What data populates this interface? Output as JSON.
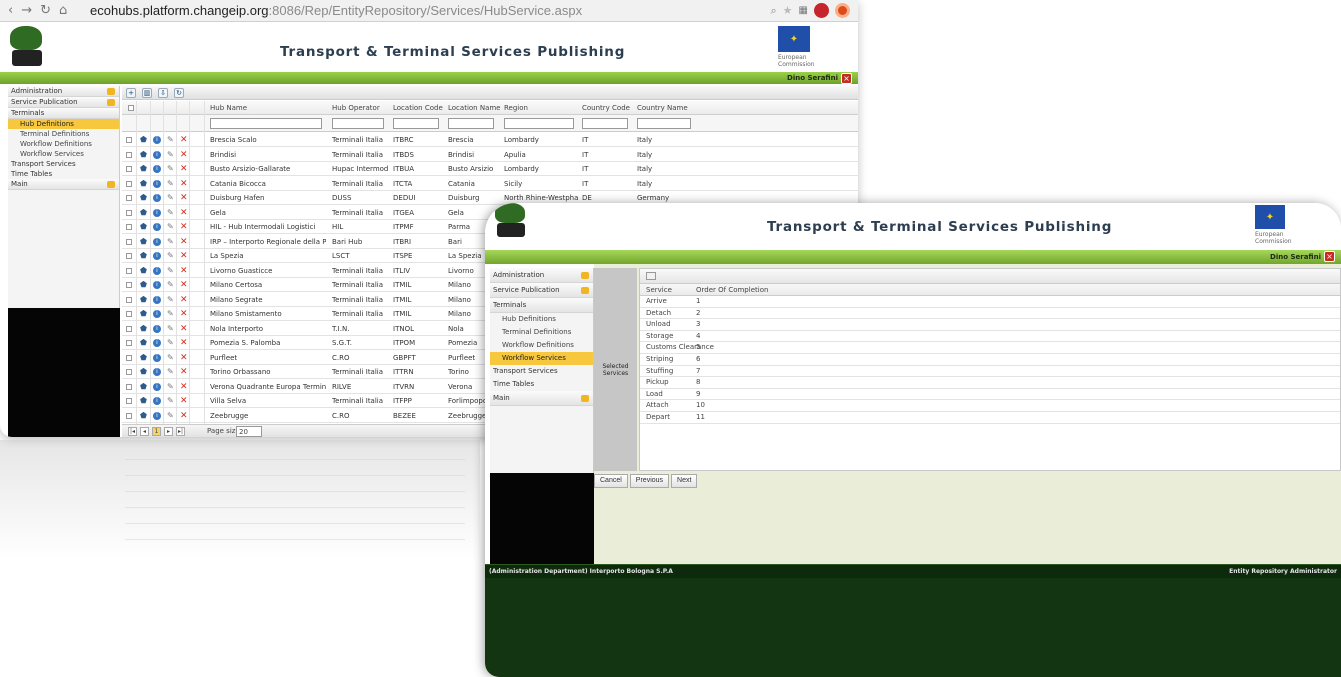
{
  "back": {
    "browser": {
      "url_host": "ecohubs.platform.changeip.org",
      "url_path": ":8086/Rep/EntityRepository/Services/HubService.aspx"
    },
    "title": "Transport & Terminal Services Publishing",
    "eu_caption": "European Commission",
    "user": "Dino Serafini",
    "menu": {
      "administration": "Administration",
      "service_publication": "Service Publication",
      "terminals": "Terminals",
      "hub_definitions": "Hub Definitions",
      "terminal_definitions": "Terminal Definitions",
      "workflow_definitions": "Workflow Definitions",
      "workflow_services": "Workflow Services",
      "transport_services": "Transport Services",
      "time_tables": "Time Tables",
      "main": "Main"
    },
    "columns": [
      "Hub Name",
      "Hub Operator",
      "Location Code",
      "Location Name",
      "Region",
      "Country Code",
      "Country Name"
    ],
    "rows": [
      [
        "Brescia Scalo",
        "Terminali Italia",
        "ITBRC",
        "Brescia",
        "Lombardy",
        "IT",
        "Italy"
      ],
      [
        "Brindisi",
        "Terminali Italia",
        "ITBDS",
        "Brindisi",
        "Apulia",
        "IT",
        "Italy"
      ],
      [
        "Busto Arsizio-Gallarate",
        "Hupac Intermodal",
        "ITBUA",
        "Busto Arsizio",
        "Lombardy",
        "IT",
        "Italy"
      ],
      [
        "Catania Bicocca",
        "Terminali Italia",
        "ITCTA",
        "Catania",
        "Sicily",
        "IT",
        "Italy"
      ],
      [
        "Duisburg Hafen",
        "DUSS",
        "DEDUI",
        "Duisburg",
        "North Rhine-Westphalia",
        "DE",
        "Germany"
      ],
      [
        "Gela",
        "Terminali Italia",
        "ITGEA",
        "Gela",
        "",
        "",
        ""
      ],
      [
        "HIL - Hub Intermodali Logistici",
        "HIL",
        "ITPMF",
        "Parma",
        "",
        "",
        ""
      ],
      [
        "IRP – Interporto Regionale della Puglia",
        "Bari Hub",
        "ITBRI",
        "Bari",
        "",
        "",
        ""
      ],
      [
        "La Spezia",
        "LSCT",
        "ITSPE",
        "La Spezia",
        "",
        "",
        ""
      ],
      [
        "Livorno Guasticce",
        "Terminali Italia",
        "ITLIV",
        "Livorno",
        "",
        "",
        ""
      ],
      [
        "Milano Certosa",
        "Terminali Italia",
        "ITMIL",
        "Milano",
        "",
        "",
        ""
      ],
      [
        "Milano Segrate",
        "Terminali Italia",
        "ITMIL",
        "Milano",
        "",
        "",
        ""
      ],
      [
        "Milano Smistamento",
        "Terminali Italia",
        "ITMIL",
        "Milano",
        "",
        "",
        ""
      ],
      [
        "Nola Interporto",
        "T.I.N.",
        "ITNOL",
        "Nola",
        "",
        "",
        ""
      ],
      [
        "Pomezia S. Palomba",
        "S.G.T.",
        "ITPOM",
        "Pomezia",
        "",
        "",
        ""
      ],
      [
        "Purfleet",
        "C.RO",
        "GBPFT",
        "Purfleet",
        "",
        "",
        ""
      ],
      [
        "Torino Orbassano",
        "Terminali Italia",
        "ITTRN",
        "Torino",
        "",
        "",
        ""
      ],
      [
        "Verona Quadrante Europa Terminal",
        "RILVE",
        "ITVRN",
        "Verona",
        "",
        "",
        ""
      ],
      [
        "Villa Selva",
        "Terminali Italia",
        "ITFPP",
        "Forlimpopo",
        "",
        "",
        ""
      ],
      [
        "Zeebrugge",
        "C.RO",
        "BEZEE",
        "Zeebrugge",
        "",
        "",
        ""
      ]
    ],
    "pager": {
      "current_page": "1",
      "page_size_label": "Page size:",
      "page_size": "20"
    }
  },
  "front": {
    "title": "Transport & Terminal Services Publishing",
    "eu_caption": "European Commission",
    "user": "Dino Serafini",
    "menu": {
      "administration": "Administration",
      "service_publication": "Service Publication",
      "terminals": "Terminals",
      "hub_definitions": "Hub Definitions",
      "terminal_definitions": "Terminal Definitions",
      "workflow_definitions": "Workflow Definitions",
      "workflow_services": "Workflow Services",
      "transport_services": "Transport Services",
      "time_tables": "Time Tables",
      "main": "Main"
    },
    "selected_services_label": "Selected Services",
    "columns": [
      "Service",
      "Order Of Completion"
    ],
    "rows": [
      [
        "Arrive",
        "1"
      ],
      [
        "Detach",
        "2"
      ],
      [
        "Unload",
        "3"
      ],
      [
        "Storage",
        "4"
      ],
      [
        "Customs Clearance",
        "5"
      ],
      [
        "Striping",
        "6"
      ],
      [
        "Stuffing",
        "7"
      ],
      [
        "Pickup",
        "8"
      ],
      [
        "Load",
        "9"
      ],
      [
        "Attach",
        "10"
      ],
      [
        "Depart",
        "11"
      ]
    ],
    "buttons": {
      "cancel": "Cancel",
      "previous": "Previous",
      "next": "Next"
    },
    "footer_left": "(Administration Department) Interporto Bologna S.P.A",
    "footer_right": "Entity Repository Administrator"
  }
}
